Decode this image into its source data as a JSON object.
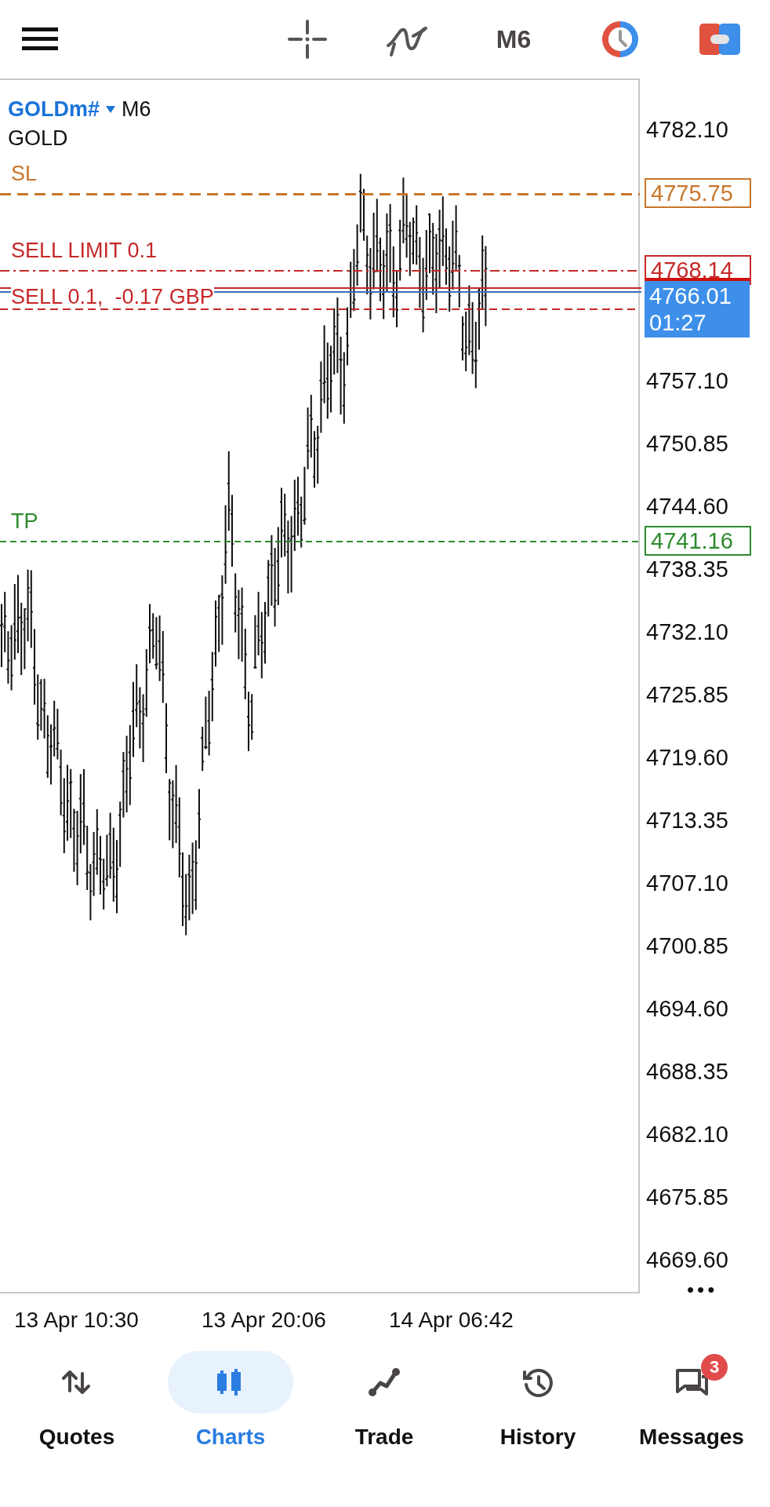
{
  "toolbar": {
    "timeframe": "M6"
  },
  "chart": {
    "symbol": "GOLDm#",
    "timeframe": "M6",
    "description": "GOLD",
    "price_axis": [
      "4782.10",
      "4757.10",
      "4750.85",
      "4744.60",
      "4738.35",
      "4732.10",
      "4725.85",
      "4719.60",
      "4713.35",
      "4707.10",
      "4700.85",
      "4694.60",
      "4688.35",
      "4682.10",
      "4675.85",
      "4669.60"
    ],
    "levels": [
      {
        "kind": "sl",
        "label": "SL",
        "price": "4775.75",
        "color": "#c8762a"
      },
      {
        "kind": "sell_limit",
        "label": "SELL LIMIT 0.1",
        "price": "4768.14",
        "color": "#c62828"
      },
      {
        "kind": "position",
        "label": "SELL 0.1,  -0.17 GBP",
        "color": "#c62828"
      },
      {
        "kind": "tp",
        "label": "TP",
        "price": "4741.16",
        "color": "#2e8b2e"
      }
    ],
    "bid": {
      "price": "4766.01",
      "countdown": "01:27"
    },
    "more": "•••",
    "time_axis": [
      "13 Apr 10:30",
      "13 Apr 20:06",
      "14 Apr 06:42"
    ]
  },
  "nav": [
    {
      "kind": "quotes",
      "label": "Quotes",
      "selected": false
    },
    {
      "kind": "charts",
      "label": "Charts",
      "selected": true
    },
    {
      "kind": "trade",
      "label": "Trade",
      "selected": false
    },
    {
      "kind": "history",
      "label": "History",
      "selected": false
    },
    {
      "kind": "messages",
      "label": "Messages",
      "selected": false,
      "badge": "3"
    }
  ]
}
